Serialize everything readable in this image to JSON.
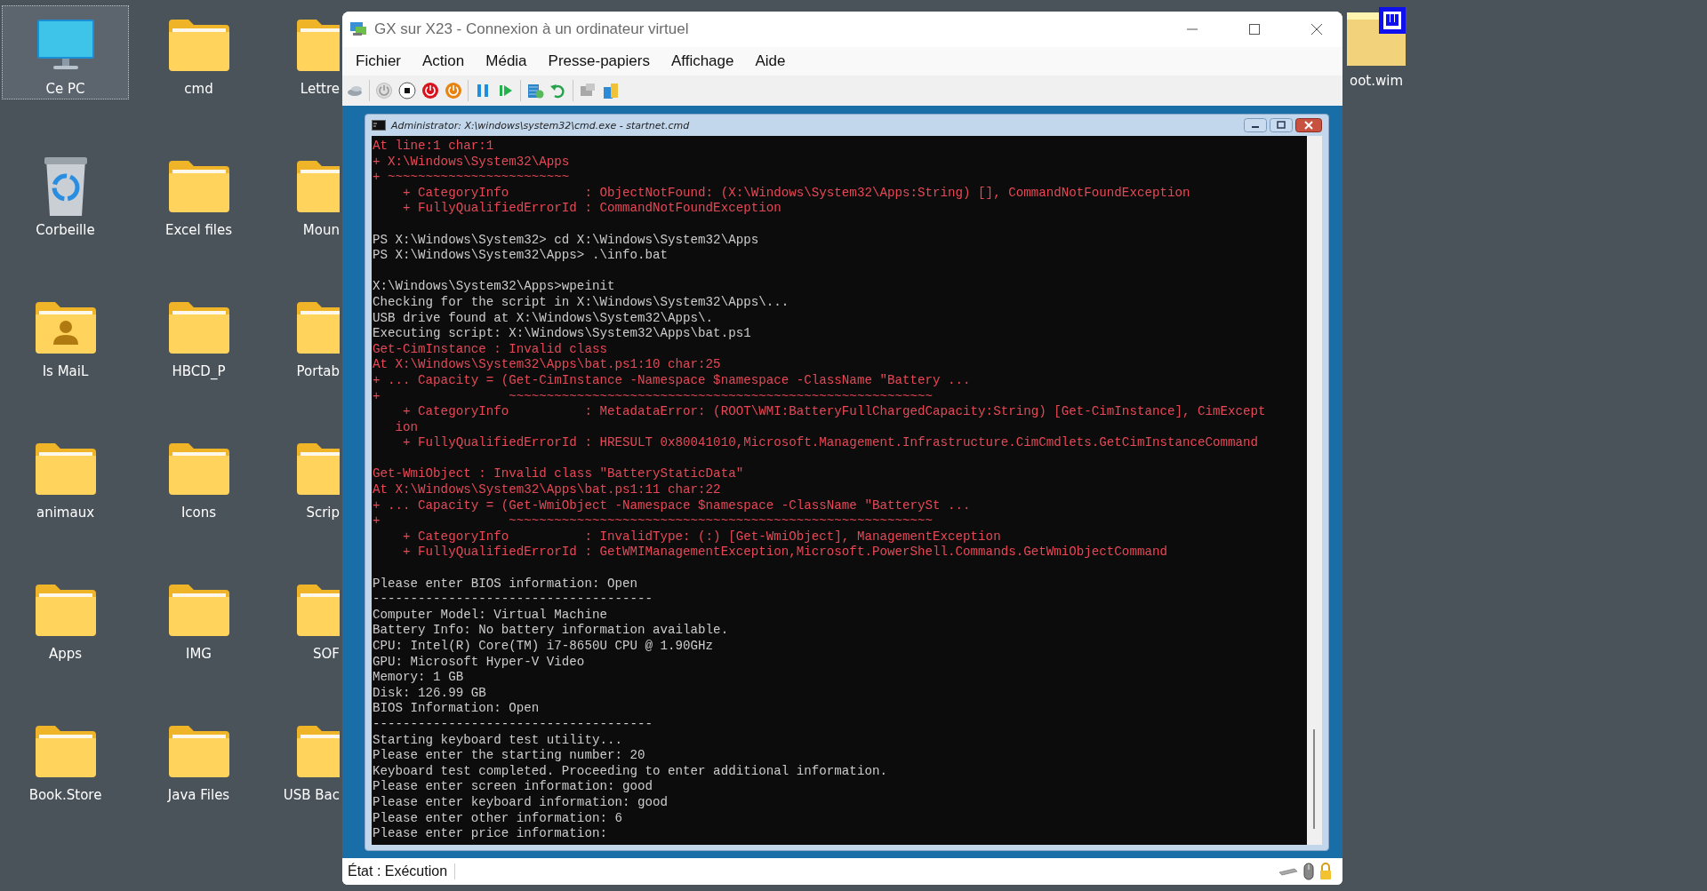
{
  "desktop": {
    "icons": [
      {
        "label": "Ce PC",
        "kind": "pc",
        "selected": true
      },
      {
        "label": "cmd",
        "kind": "folder",
        "selected": false
      },
      {
        "label": "Lettre",
        "kind": "partial-folder",
        "selected": false
      },
      {
        "label": "Corbeille",
        "kind": "bin",
        "selected": false
      },
      {
        "label": "Excel files",
        "kind": "folder",
        "selected": false
      },
      {
        "label": "Moun",
        "kind": "partial-folder",
        "selected": false
      },
      {
        "label": "Is MaiL",
        "kind": "user-folder",
        "selected": false
      },
      {
        "label": "HBCD_P",
        "kind": "folder",
        "selected": false
      },
      {
        "label": "Portab",
        "kind": "partial-folder",
        "selected": false
      },
      {
        "label": "animaux",
        "kind": "folder",
        "selected": false
      },
      {
        "label": "Icons",
        "kind": "folder",
        "selected": false
      },
      {
        "label": "Scrip",
        "kind": "partial-folder",
        "selected": false
      },
      {
        "label": "Apps",
        "kind": "folder",
        "selected": false
      },
      {
        "label": "IMG",
        "kind": "folder",
        "selected": false
      },
      {
        "label": "SOF",
        "kind": "partial-folder",
        "selected": false
      },
      {
        "label": "Book.Store",
        "kind": "folder",
        "selected": false
      },
      {
        "label": "Java Files",
        "kind": "folder",
        "selected": false
      },
      {
        "label": "USB Bac",
        "kind": "partial-folder",
        "selected": false
      }
    ],
    "corner_icon": {
      "label": "oot.wim",
      "kind": "wim"
    }
  },
  "window": {
    "title": "GX sur X23 - Connexion à un ordinateur virtuel",
    "menu": [
      "Fichier",
      "Action",
      "Média",
      "Presse-papiers",
      "Affichage",
      "Aide"
    ],
    "console_window": {
      "title": "Administrator: X:\\windows\\system32\\cmd.exe - startnet.cmd",
      "blocks": [
        {
          "lines": [
            {
              "text": "At line:1 char:1",
              "kind": "error"
            },
            {
              "text": "+ X:\\Windows\\System32\\Apps",
              "kind": "error"
            },
            {
              "text": "+ ~~~~~~~~~~~~~~~~~~~~~~~~",
              "kind": "error"
            },
            {
              "text": "    + CategoryInfo          : ObjectNotFound: (X:\\Windows\\System32\\Apps:String) [], CommandNotFoundException",
              "kind": "error"
            },
            {
              "text": "    + FullyQualifiedErrorId : CommandNotFoundException",
              "kind": "error"
            }
          ]
        },
        {
          "lines": [
            {
              "text": "PS X:\\Windows\\System32> cd X:\\Windows\\System32\\Apps",
              "kind": "output"
            },
            {
              "text": "PS X:\\Windows\\System32\\Apps> .\\info.bat",
              "kind": "output"
            }
          ]
        },
        {
          "lines": [
            {
              "text": "X:\\Windows\\System32\\Apps>wpeinit",
              "kind": "output"
            },
            {
              "text": "Checking for the script in X:\\Windows\\System32\\Apps\\...",
              "kind": "output"
            },
            {
              "text": "USB drive found at X:\\Windows\\System32\\Apps\\.",
              "kind": "output"
            },
            {
              "text": "Executing script: X:\\Windows\\System32\\Apps\\bat.ps1",
              "kind": "output"
            },
            {
              "text": "Get-CimInstance : Invalid class",
              "kind": "error"
            },
            {
              "text": "At X:\\Windows\\System32\\Apps\\bat.ps1:10 char:25",
              "kind": "error"
            },
            {
              "text": "+ ... Capacity = (Get-CimInstance -Namespace $namespace -ClassName \"Battery ...",
              "kind": "error"
            },
            {
              "text": "+                 ~~~~~~~~~~~~~~~~~~~~~~~~~~~~~~~~~~~~~~~~~~~~~~~~~~~~~~~~",
              "kind": "error"
            },
            {
              "text": "    + CategoryInfo          : MetadataError: (ROOT\\WMI:BatteryFullChargedCapacity:String) [Get-CimInstance], CimExcept",
              "kind": "error"
            },
            {
              "text": "   ion",
              "kind": "error"
            },
            {
              "text": "    + FullyQualifiedErrorId : HRESULT 0x80041010,Microsoft.Management.Infrastructure.CimCmdlets.GetCimInstanceCommand",
              "kind": "error"
            }
          ]
        },
        {
          "lines": [
            {
              "text": "Get-WmiObject : Invalid class \"BatteryStaticData\"",
              "kind": "error"
            },
            {
              "text": "At X:\\Windows\\System32\\Apps\\bat.ps1:11 char:22",
              "kind": "error"
            },
            {
              "text": "+ ... Capacity = (Get-WmiObject -Namespace $namespace -ClassName \"BatterySt ...",
              "kind": "error"
            },
            {
              "text": "+                 ~~~~~~~~~~~~~~~~~~~~~~~~~~~~~~~~~~~~~~~~~~~~~~~~~~~~~~~~",
              "kind": "error"
            },
            {
              "text": "    + CategoryInfo          : InvalidType: (:) [Get-WmiObject], ManagementException",
              "kind": "error"
            },
            {
              "text": "    + FullyQualifiedErrorId : GetWMIManagementException,Microsoft.PowerShell.Commands.GetWmiObjectCommand",
              "kind": "error"
            }
          ]
        },
        {
          "lines": [
            {
              "text": "Please enter BIOS information: Open",
              "kind": "output"
            },
            {
              "text": "-------------------------------------",
              "kind": "output"
            },
            {
              "text": "Computer Model: Virtual Machine",
              "kind": "output"
            },
            {
              "text": "Battery Info: No battery information available.",
              "kind": "output"
            },
            {
              "text": "CPU: Intel(R) Core(TM) i7-8650U CPU @ 1.90GHz",
              "kind": "output"
            },
            {
              "text": "GPU: Microsoft Hyper-V Video",
              "kind": "output"
            },
            {
              "text": "Memory: 1 GB",
              "kind": "output"
            },
            {
              "text": "Disk: 126.99 GB",
              "kind": "output"
            },
            {
              "text": "BIOS Information: Open",
              "kind": "output"
            },
            {
              "text": "-------------------------------------",
              "kind": "output"
            },
            {
              "text": "Starting keyboard test utility...",
              "kind": "output"
            },
            {
              "text": "Please enter the starting number: 20",
              "kind": "output"
            },
            {
              "text": "Keyboard test completed. Proceeding to enter additional information.",
              "kind": "output"
            },
            {
              "text": "Please enter screen information: good",
              "kind": "output"
            },
            {
              "text": "Please enter keyboard information: good",
              "kind": "output"
            },
            {
              "text": "Please enter other information: 6",
              "kind": "output"
            },
            {
              "text": "Please enter price information:",
              "kind": "output"
            }
          ]
        }
      ]
    },
    "status_bar": {
      "state": "État : Exécution"
    }
  }
}
